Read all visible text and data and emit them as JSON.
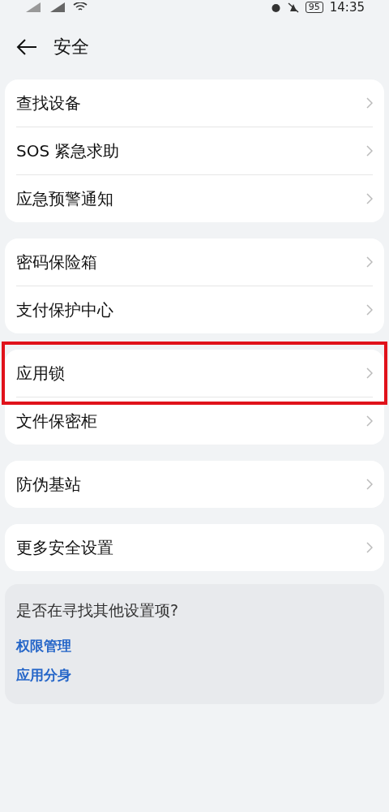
{
  "status_bar": {
    "battery": "95",
    "time": "14:35"
  },
  "header": {
    "title": "安全"
  },
  "groups": [
    {
      "items": [
        {
          "label": "查找设备",
          "highlighted": false
        },
        {
          "label": "SOS 紧急求助",
          "highlighted": false
        },
        {
          "label": "应急预警通知",
          "highlighted": false
        }
      ]
    },
    {
      "items": [
        {
          "label": "密码保险箱",
          "highlighted": false
        },
        {
          "label": "支付保护中心",
          "highlighted": false
        }
      ]
    },
    {
      "items": [
        {
          "label": "应用锁",
          "highlighted": true
        },
        {
          "label": "文件保密柜",
          "highlighted": false
        }
      ]
    },
    {
      "items": [
        {
          "label": "防伪基站",
          "highlighted": false
        }
      ]
    },
    {
      "items": [
        {
          "label": "更多安全设置",
          "highlighted": false
        }
      ]
    }
  ],
  "suggestions": {
    "title": "是否在寻找其他设置项?",
    "links": [
      "权限管理",
      "应用分身"
    ]
  }
}
